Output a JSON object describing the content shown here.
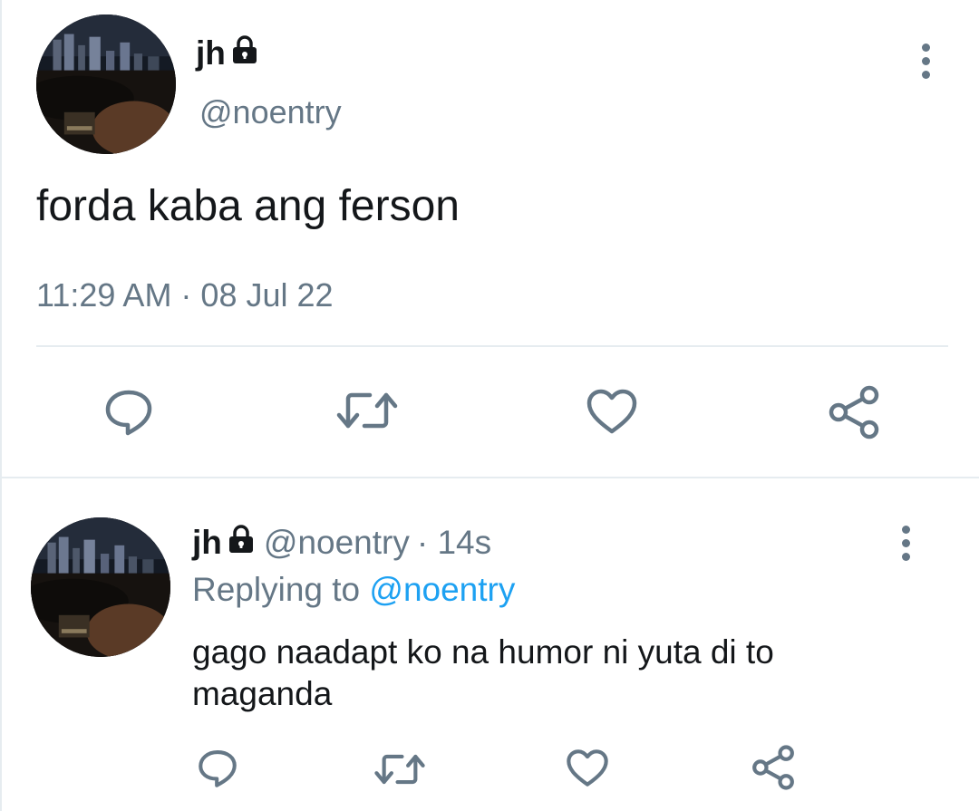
{
  "main_tweet": {
    "author_name": "jh",
    "author_handle": "@noentry",
    "text": "forda kaba ang ferson",
    "timestamp": "11:29 AM · 08 Jul 22",
    "actions": [
      "reply-icon",
      "retweet-icon",
      "like-icon",
      "share-icon"
    ]
  },
  "reply": {
    "author_name": "jh",
    "author_handle": "@noentry",
    "age": "· 14s",
    "replying_prefix": "Replying to",
    "replying_mention": "@noentry",
    "text": "gago naadapt ko na humor ni yuta di to maganda",
    "actions": [
      "reply-icon",
      "retweet-icon",
      "like-icon",
      "share-icon"
    ]
  },
  "colors": {
    "text": "#14171a",
    "secondary": "#657786",
    "link": "#1da1f2",
    "divider": "#e6ecf0"
  }
}
